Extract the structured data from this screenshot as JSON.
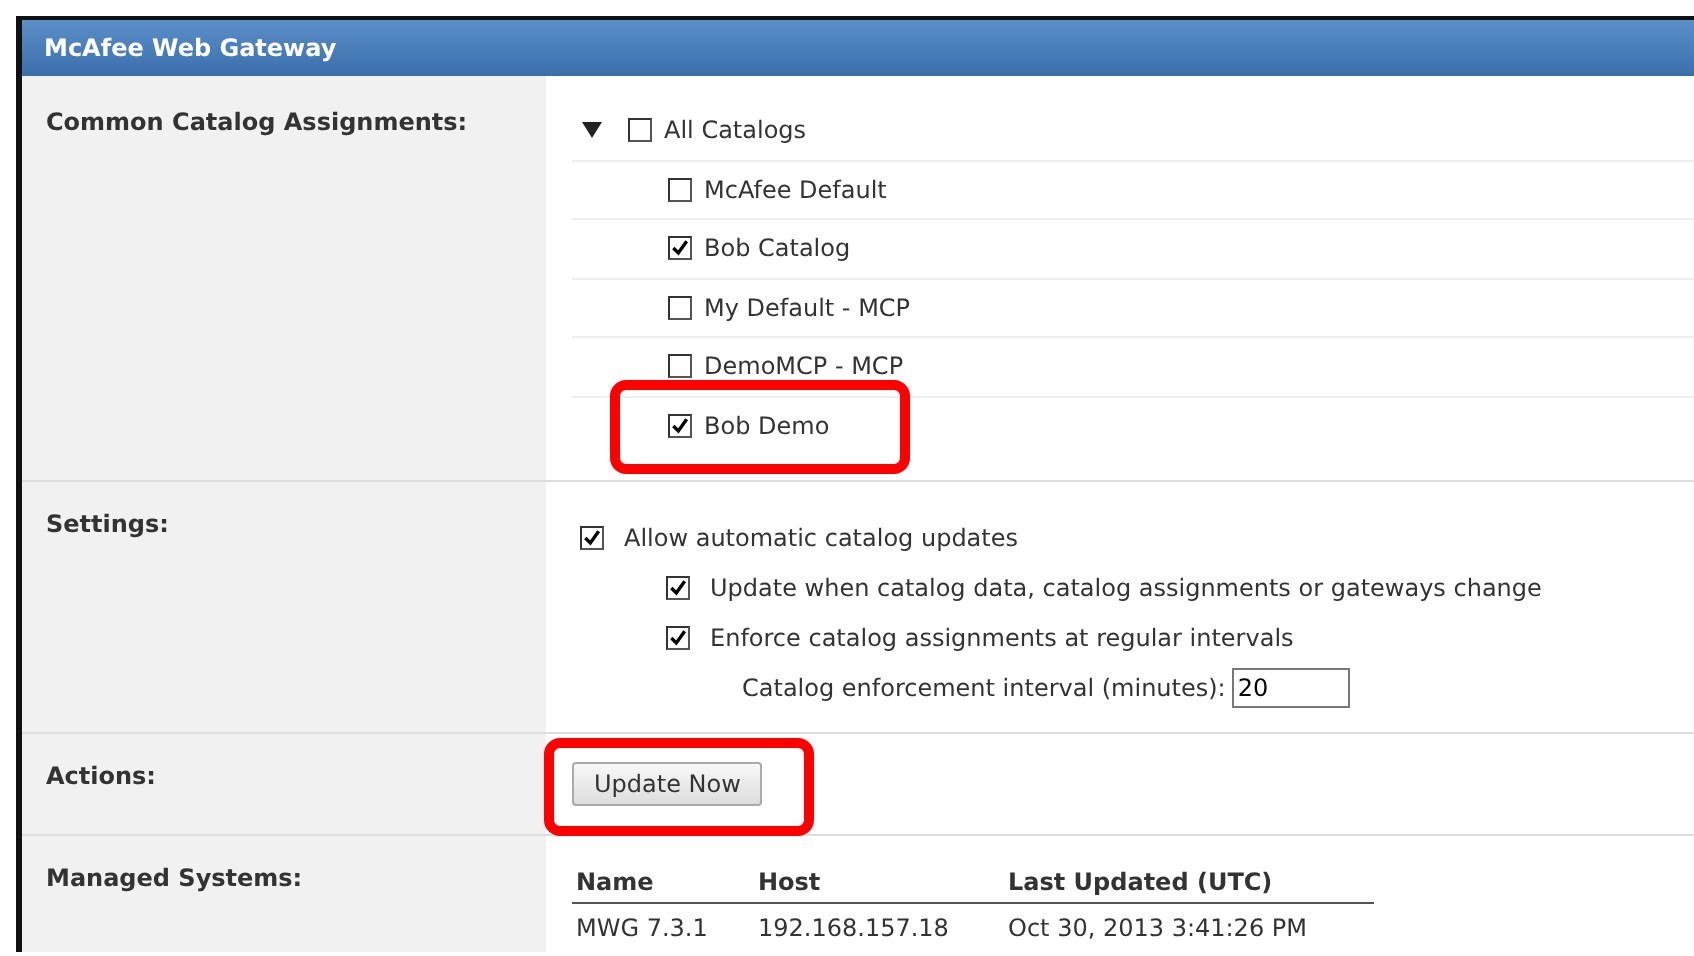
{
  "window": {
    "title": "McAfee Web Gateway"
  },
  "sections": [
    {
      "kind": "catalogs",
      "label": "Common Catalog Assignments:",
      "tree": {
        "label": "All Catalogs",
        "checked": false,
        "expanded": true,
        "children": [
          {
            "label": "McAfee Default",
            "checked": false,
            "highlighted": false
          },
          {
            "label": "Bob Catalog",
            "checked": true,
            "highlighted": false
          },
          {
            "label": "My Default - MCP",
            "checked": false,
            "highlighted": false
          },
          {
            "label": "DemoMCP - MCP",
            "checked": false,
            "highlighted": false
          },
          {
            "label": "Bob Demo",
            "checked": true,
            "highlighted": true
          }
        ]
      }
    },
    {
      "kind": "settings",
      "label": "Settings:",
      "option": {
        "label": "Allow automatic catalog updates",
        "checked": true,
        "children": [
          {
            "label": "Update when catalog data, catalog assignments or gateways change",
            "checked": true
          },
          {
            "label": "Enforce catalog assignments at regular intervals",
            "checked": true
          }
        ]
      },
      "interval": {
        "label": "Catalog enforcement interval (minutes):",
        "value": "20"
      }
    },
    {
      "kind": "actions",
      "label": "Actions:",
      "button": {
        "label": "Update Now",
        "highlighted": true
      }
    },
    {
      "kind": "table",
      "label": "Managed Systems:",
      "columns": [
        "Name",
        "Host",
        "Last Updated (UTC)"
      ],
      "rows": [
        [
          "MWG 7.3.1",
          "192.168.157.18",
          "Oct 30, 2013 3:41:26 PM"
        ]
      ]
    }
  ]
}
